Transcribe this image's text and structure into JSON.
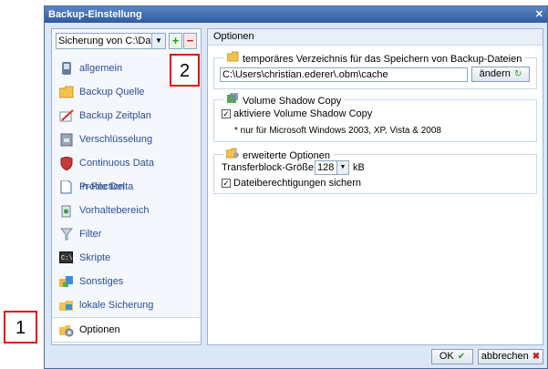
{
  "window": {
    "title": "Backup-Einstellung",
    "close_glyph": "✕"
  },
  "sidebar": {
    "selector_value": "Sicherung von C:\\Daten",
    "add_label": "+",
    "remove_label": "−",
    "items": [
      {
        "label": "allgemein",
        "icon": "device-icon"
      },
      {
        "label": "Backup Quelle",
        "icon": "folder-icon"
      },
      {
        "label": "Backup Zeitplan",
        "icon": "calendar-pen-icon"
      },
      {
        "label": "Verschlüsselung",
        "icon": "lock-icon"
      },
      {
        "label": "Continuous Data Protection",
        "icon": "shield-icon"
      },
      {
        "label": "In-File Delta",
        "icon": "document-icon"
      },
      {
        "label": "Vorhaltebereich",
        "icon": "recycle-bin-icon"
      },
      {
        "label": "Filter",
        "icon": "funnel-icon"
      },
      {
        "label": "Skripte",
        "icon": "script-icon"
      },
      {
        "label": "Sonstiges",
        "icon": "puzzle-icon"
      },
      {
        "label": "lokale Sicherung",
        "icon": "local-backup-icon"
      },
      {
        "label": "Optionen",
        "icon": "options-icon"
      }
    ],
    "active_index": 11
  },
  "main": {
    "header": "Optionen",
    "temp_dir": {
      "title": "temporäres Verzeichnis für das Speichern von Backup-Dateien",
      "path": "C:\\Users\\christian.ederer\\.obm\\cache",
      "change_button": "ändern"
    },
    "vss": {
      "title": "Volume Shadow Copy",
      "checkbox_label": "aktiviere Volume Shadow Copy",
      "checked": true,
      "note": "* nur für Microsoft Windows 2003, XP, Vista & 2008"
    },
    "advanced": {
      "title": "erweiterte Optionen",
      "transfer_label": "Transferblock-Größe :",
      "transfer_value": "128",
      "transfer_unit": "kB",
      "permissions_label": "Dateiberechtigungen sichern",
      "permissions_checked": true
    }
  },
  "footer": {
    "ok_label": "OK",
    "cancel_label": "abbrechen"
  },
  "callouts": {
    "one": "1",
    "two": "2"
  }
}
